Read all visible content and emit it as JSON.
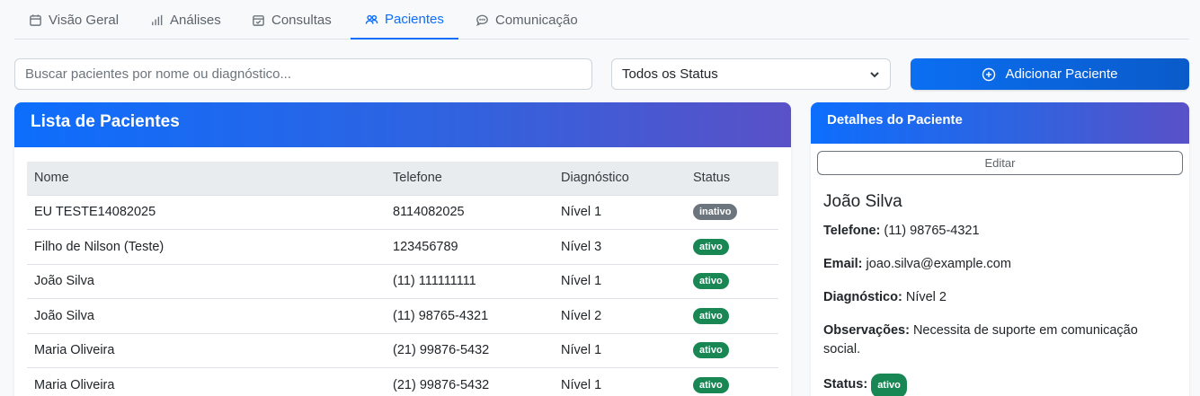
{
  "tabs": [
    {
      "label": "Visão Geral",
      "icon": "calendar-icon"
    },
    {
      "label": "Análises",
      "icon": "bar-chart-icon"
    },
    {
      "label": "Consultas",
      "icon": "calendar-check-icon"
    },
    {
      "label": "Pacientes",
      "icon": "people-icon",
      "active": true
    },
    {
      "label": "Comunicação",
      "icon": "chat-icon"
    }
  ],
  "search": {
    "placeholder": "Buscar pacientes por nome ou diagnóstico...",
    "value": ""
  },
  "status_filter": {
    "selected": "Todos os Status"
  },
  "add_button": {
    "label": "Adicionar Paciente"
  },
  "patient_list": {
    "title": "Lista de Pacientes",
    "columns": [
      "Nome",
      "Telefone",
      "Diagnóstico",
      "Status"
    ],
    "rows": [
      {
        "name": "EU TESTE14082025",
        "phone": "8114082025",
        "diagnosis": "Nível 1",
        "status": "inativo"
      },
      {
        "name": "Filho de Nilson (Teste)",
        "phone": "123456789",
        "diagnosis": "Nível 3",
        "status": "ativo"
      },
      {
        "name": "João Silva",
        "phone": "(11) 111111111",
        "diagnosis": "Nível 1",
        "status": "ativo"
      },
      {
        "name": "João Silva",
        "phone": "(11) 98765-4321",
        "diagnosis": "Nível 2",
        "status": "ativo"
      },
      {
        "name": "Maria Oliveira",
        "phone": "(21) 99876-5432",
        "diagnosis": "Nível 1",
        "status": "ativo"
      },
      {
        "name": "Maria Oliveira",
        "phone": "(21) 99876-5432",
        "diagnosis": "Nível 1",
        "status": "ativo"
      }
    ]
  },
  "details": {
    "title": "Detalhes do Paciente",
    "edit_label": "Editar",
    "name": "João Silva",
    "phone_label": "Telefone:",
    "phone": "(11) 98765-4321",
    "email_label": "Email:",
    "email": "joao.silva@example.com",
    "diagnosis_label": "Diagnóstico:",
    "diagnosis": "Nível 2",
    "notes_label": "Observações:",
    "notes": "Necessita de suporte em comunicação social.",
    "status_label": "Status:",
    "status": "ativo"
  },
  "colors": {
    "primary": "#0d6efd",
    "active_badge": "#198754",
    "inactive_badge": "#6c757d",
    "header_gradient_end": "#5a51c7"
  }
}
